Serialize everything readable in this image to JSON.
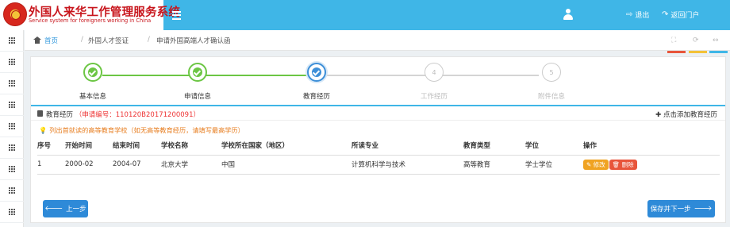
{
  "header": {
    "title_cn": "外国人来华工作管理服务系统",
    "title_en": "Service system for foreigners working in China",
    "logout_label": "退出",
    "portal_label": "返回门户"
  },
  "breadcrumb": {
    "home": "首页",
    "separator": "/",
    "level2": "外国人才签证",
    "level3": "申请外国高端人才确认函"
  },
  "steps": [
    {
      "label": "基本信息",
      "state": "done"
    },
    {
      "label": "申请信息",
      "state": "done"
    },
    {
      "label": "教育经历",
      "state": "active"
    },
    {
      "label": "工作经历",
      "state": "todo",
      "number": "4"
    },
    {
      "label": "附件信息",
      "state": "todo",
      "number": "5"
    }
  ],
  "section": {
    "title": "教育经历",
    "application_no": "（申请编号：110120B20171200091）",
    "add_link": "点击添加教育经历",
    "tip": "列出首就读的高等教育学校（如无高等教育经历，请填写最高学历）"
  },
  "table": {
    "headers": [
      "序号",
      "开始时间",
      "结束时间",
      "学校名称",
      "学校所在国家（地区）",
      "所读专业",
      "教育类型",
      "学位",
      "操作"
    ],
    "rows": [
      [
        "1",
        "2000-02",
        "2004-07",
        "北京大学",
        "中国",
        "计算机科学与技术",
        "高等教育",
        "学士学位"
      ]
    ],
    "edit_label": "修改",
    "delete_label": "删除"
  },
  "buttons": {
    "prev": "上一步",
    "save_next": "保存并下一步"
  },
  "colors": {
    "header_blue": "#3fb6e7",
    "brand_red": "#c8161d",
    "done_green": "#6cc644",
    "active_blue": "#3d8fd8",
    "button_blue": "#2e8ad8"
  }
}
